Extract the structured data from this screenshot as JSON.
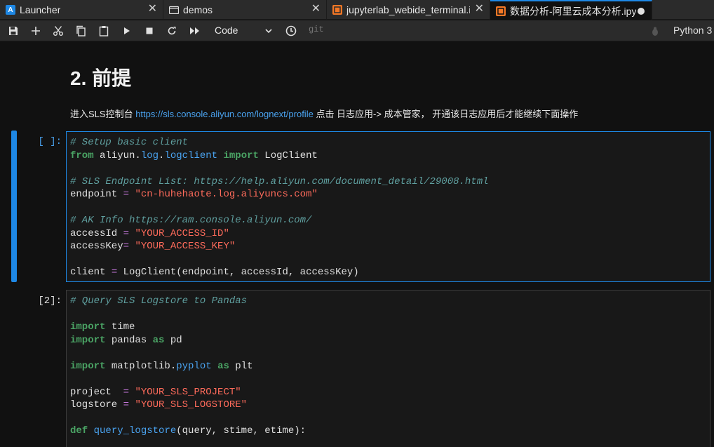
{
  "tabs": [
    {
      "label": "Launcher",
      "icon": "launcher-icon"
    },
    {
      "label": "demos",
      "icon": "folder-icon"
    },
    {
      "label": "jupyterlab_webide_terminal.ipynb",
      "icon": "notebook-icon"
    },
    {
      "label": "数据分析-阿里云成本分析.ipynb",
      "icon": "notebook-icon",
      "active": true,
      "unsaved": true
    }
  ],
  "toolbar": {
    "cell_type": "Code",
    "git_label": "git",
    "kernel_name": "Python 3"
  },
  "notebook": {
    "heading": "2. 前提",
    "para_before": "进入SLS控制台 ",
    "para_link": "https://sls.console.aliyun.com/lognext/profile",
    "para_after": " 点击 日志应用-> 成本管家， 开通该日志应用后才能继续下面操作",
    "cells": [
      {
        "prompt": "[ ]:",
        "lines": [
          [
            [
              "c",
              "# Setup basic client"
            ]
          ],
          [
            [
              "k",
              "from"
            ],
            [
              "t",
              " aliyun."
            ],
            [
              "a",
              "log"
            ],
            [
              "t",
              "."
            ],
            [
              "a",
              "logclient"
            ],
            [
              "t",
              " "
            ],
            [
              "k",
              "import"
            ],
            [
              "t",
              " LogClient"
            ]
          ],
          [],
          [
            [
              "c",
              "# SLS Endpoint List: https://help.aliyun.com/document_detail/29008.html"
            ]
          ],
          [
            [
              "t",
              "endpoint "
            ],
            [
              "o",
              "="
            ],
            [
              "t",
              " "
            ],
            [
              "s",
              "\"cn-huhehaote.log.aliyuncs.com\""
            ]
          ],
          [],
          [
            [
              "c",
              "# AK Info https://ram.console.aliyun.com/"
            ]
          ],
          [
            [
              "t",
              "accessId "
            ],
            [
              "o",
              "="
            ],
            [
              "t",
              " "
            ],
            [
              "s",
              "\"YOUR_ACCESS_ID\""
            ]
          ],
          [
            [
              "t",
              "accessKey"
            ],
            [
              "o",
              "="
            ],
            [
              "t",
              " "
            ],
            [
              "s",
              "\"YOUR_ACCESS_KEY\""
            ]
          ],
          [],
          [
            [
              "t",
              "client "
            ],
            [
              "o",
              "="
            ],
            [
              "t",
              " LogClient(endpoint, accessId, accessKey)"
            ]
          ]
        ]
      },
      {
        "prompt": "[2]:",
        "lines": [
          [
            [
              "c",
              "# Query SLS Logstore to Pandas"
            ]
          ],
          [],
          [
            [
              "k",
              "import"
            ],
            [
              "t",
              " time"
            ]
          ],
          [
            [
              "k",
              "import"
            ],
            [
              "t",
              " pandas "
            ],
            [
              "k",
              "as"
            ],
            [
              "t",
              " pd"
            ]
          ],
          [],
          [
            [
              "k",
              "import"
            ],
            [
              "t",
              " matplotlib."
            ],
            [
              "a",
              "pyplot"
            ],
            [
              "t",
              " "
            ],
            [
              "k",
              "as"
            ],
            [
              "t",
              " plt"
            ]
          ],
          [],
          [
            [
              "t",
              "project  "
            ],
            [
              "o",
              "="
            ],
            [
              "t",
              " "
            ],
            [
              "s",
              "\"YOUR_SLS_PROJECT\""
            ]
          ],
          [
            [
              "t",
              "logstore "
            ],
            [
              "o",
              "="
            ],
            [
              "t",
              " "
            ],
            [
              "s",
              "\"YOUR_SLS_LOGSTORE\""
            ]
          ],
          [],
          [
            [
              "k",
              "def"
            ],
            [
              "t",
              " "
            ],
            [
              "f",
              "query_logstore"
            ],
            [
              "t",
              "(query, stime, etime):"
            ]
          ]
        ]
      }
    ]
  },
  "colors": {
    "accent": "#1e88e5",
    "comment": "#5f9f9f",
    "keyword": "#4aa364",
    "string": "#ff6b5b",
    "operator": "#c678dd",
    "attribute": "#4aa3f0",
    "notebook_icon": "#f37726"
  }
}
